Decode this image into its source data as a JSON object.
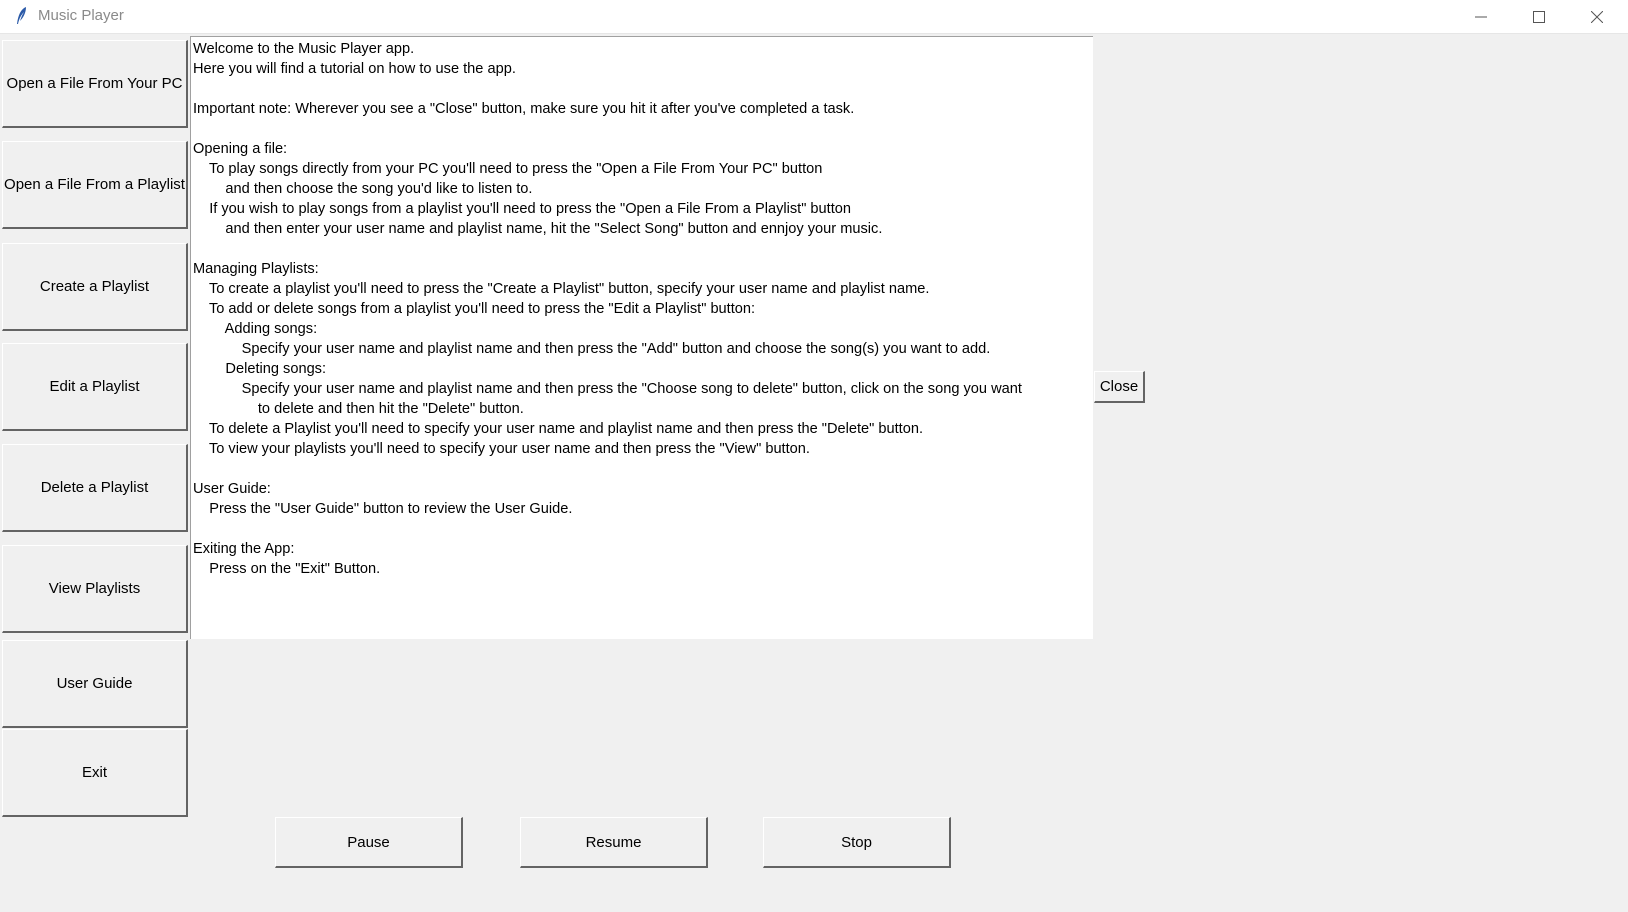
{
  "window": {
    "title": "Music Player"
  },
  "sidebar": {
    "items": [
      {
        "label": "Open a File From Your PC"
      },
      {
        "label": "Open a File From a Playlist"
      },
      {
        "label": "Create a Playlist"
      },
      {
        "label": "Edit a Playlist"
      },
      {
        "label": "Delete a Playlist"
      },
      {
        "label": "View Playlists"
      },
      {
        "label": "User Guide"
      },
      {
        "label": "Exit"
      }
    ]
  },
  "guide": {
    "lines": [
      "Welcome to the Music Player app.",
      "Here you will find a tutorial on how to use the app.",
      "",
      "Important note: Wherever you see a \"Close\" button, make sure you hit it after you've completed a task.",
      "",
      "Opening a file:",
      "    To play songs directly from your PC you'll need to press the \"Open a File From Your PC\" button",
      "        and then choose the song you'd like to listen to.",
      "    If you wish to play songs from a playlist you'll need to press the \"Open a File From a Playlist\" button",
      "        and then enter your user name and playlist name, hit the \"Select Song\" button and ennjoy your music.",
      "",
      "Managing Playlists:",
      "    To create a playlist you'll need to press the \"Create a Playlist\" button, specify your user name and playlist name.",
      "    To add or delete songs from a playlist you'll need to press the \"Edit a Playlist\" button:",
      "        Adding songs:",
      "            Specify your user name and playlist name and then press the \"Add\" button and choose the song(s) you want to add.",
      "        Deleting songs:",
      "            Specify your user name and playlist name and then press the \"Choose song to delete\" button, click on the song you want",
      "                to delete and then hit the \"Delete\" button.",
      "    To delete a Playlist you'll need to specify your user name and playlist name and then press the \"Delete\" button.",
      "    To view your playlists you'll need to specify your user name and then press the \"View\" button.",
      "",
      "User Guide:",
      "    Press the \"User Guide\" button to review the User Guide.",
      "",
      "Exiting the App:",
      "    Press on the \"Exit\" Button."
    ],
    "close_label": "Close"
  },
  "controls": {
    "pause_label": "Pause",
    "resume_label": "Resume",
    "stop_label": "Stop"
  },
  "icons": {
    "app": "feather-icon",
    "minimize": "minimize-icon",
    "maximize": "maximize-icon",
    "close": "close-icon"
  }
}
